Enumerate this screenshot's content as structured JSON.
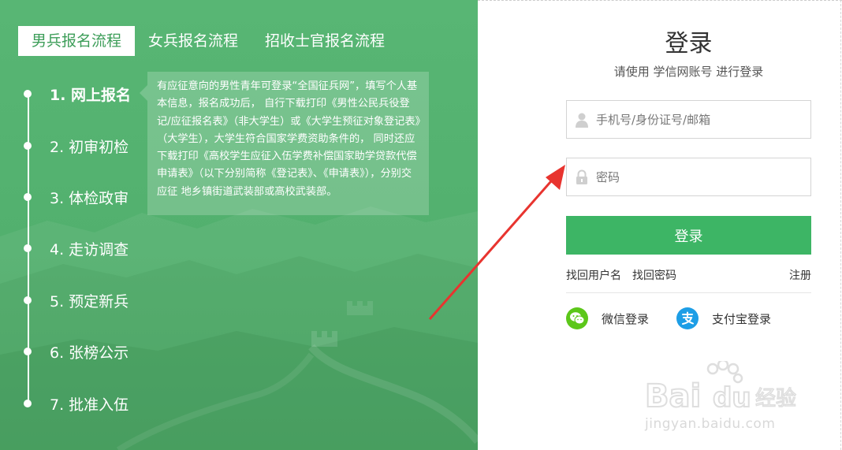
{
  "tabs": [
    {
      "label": "男兵报名流程",
      "active": true
    },
    {
      "label": "女兵报名流程",
      "active": false
    },
    {
      "label": "招收士官报名流程",
      "active": false
    }
  ],
  "steps": [
    {
      "label": "1. 网上报名",
      "active": true
    },
    {
      "label": "2. 初审初检",
      "active": false
    },
    {
      "label": "3. 体检政审",
      "active": false
    },
    {
      "label": "4. 走访调查",
      "active": false
    },
    {
      "label": "5. 预定新兵",
      "active": false
    },
    {
      "label": "6. 张榜公示",
      "active": false
    },
    {
      "label": "7. 批准入伍",
      "active": false
    }
  ],
  "description": "有应征意向的男性青年可登录“全国征兵网”，填写个人基本信息，报名成功后， 自行下载打印《男性公民兵役登记/应征报名表》（非大学生）或《大学生预征对象登记表》（大学生），大学生符合国家学费资助条件的， 同时还应下载打印《高校学生应征入伍学费补偿国家助学贷款代偿申请表》（以下分别简称《登记表》、《申请表》），分别交应征 地乡镇街道武装部或高校武装部。",
  "login": {
    "title": "登录",
    "subtitle": "请使用 学信网账号 进行登录",
    "account_placeholder": "手机号/身份证号/邮箱",
    "password_placeholder": "密码",
    "submit_label": "登录",
    "find_username": "找回用户名",
    "find_password": "找回密码",
    "register": "注册",
    "wechat_login": "微信登录",
    "alipay_login": "支付宝登录"
  },
  "watermark": {
    "brand_latin": "Bai",
    "brand_latin_2": "du",
    "brand_cn": "经验",
    "url": "jingyan.baidu.com"
  },
  "colors": {
    "panel_green": "#52b06e",
    "button_green": "#3db565",
    "wechat_green": "#5cc71a",
    "alipay_blue": "#1d9ee6",
    "arrow_red": "#e8342f"
  }
}
